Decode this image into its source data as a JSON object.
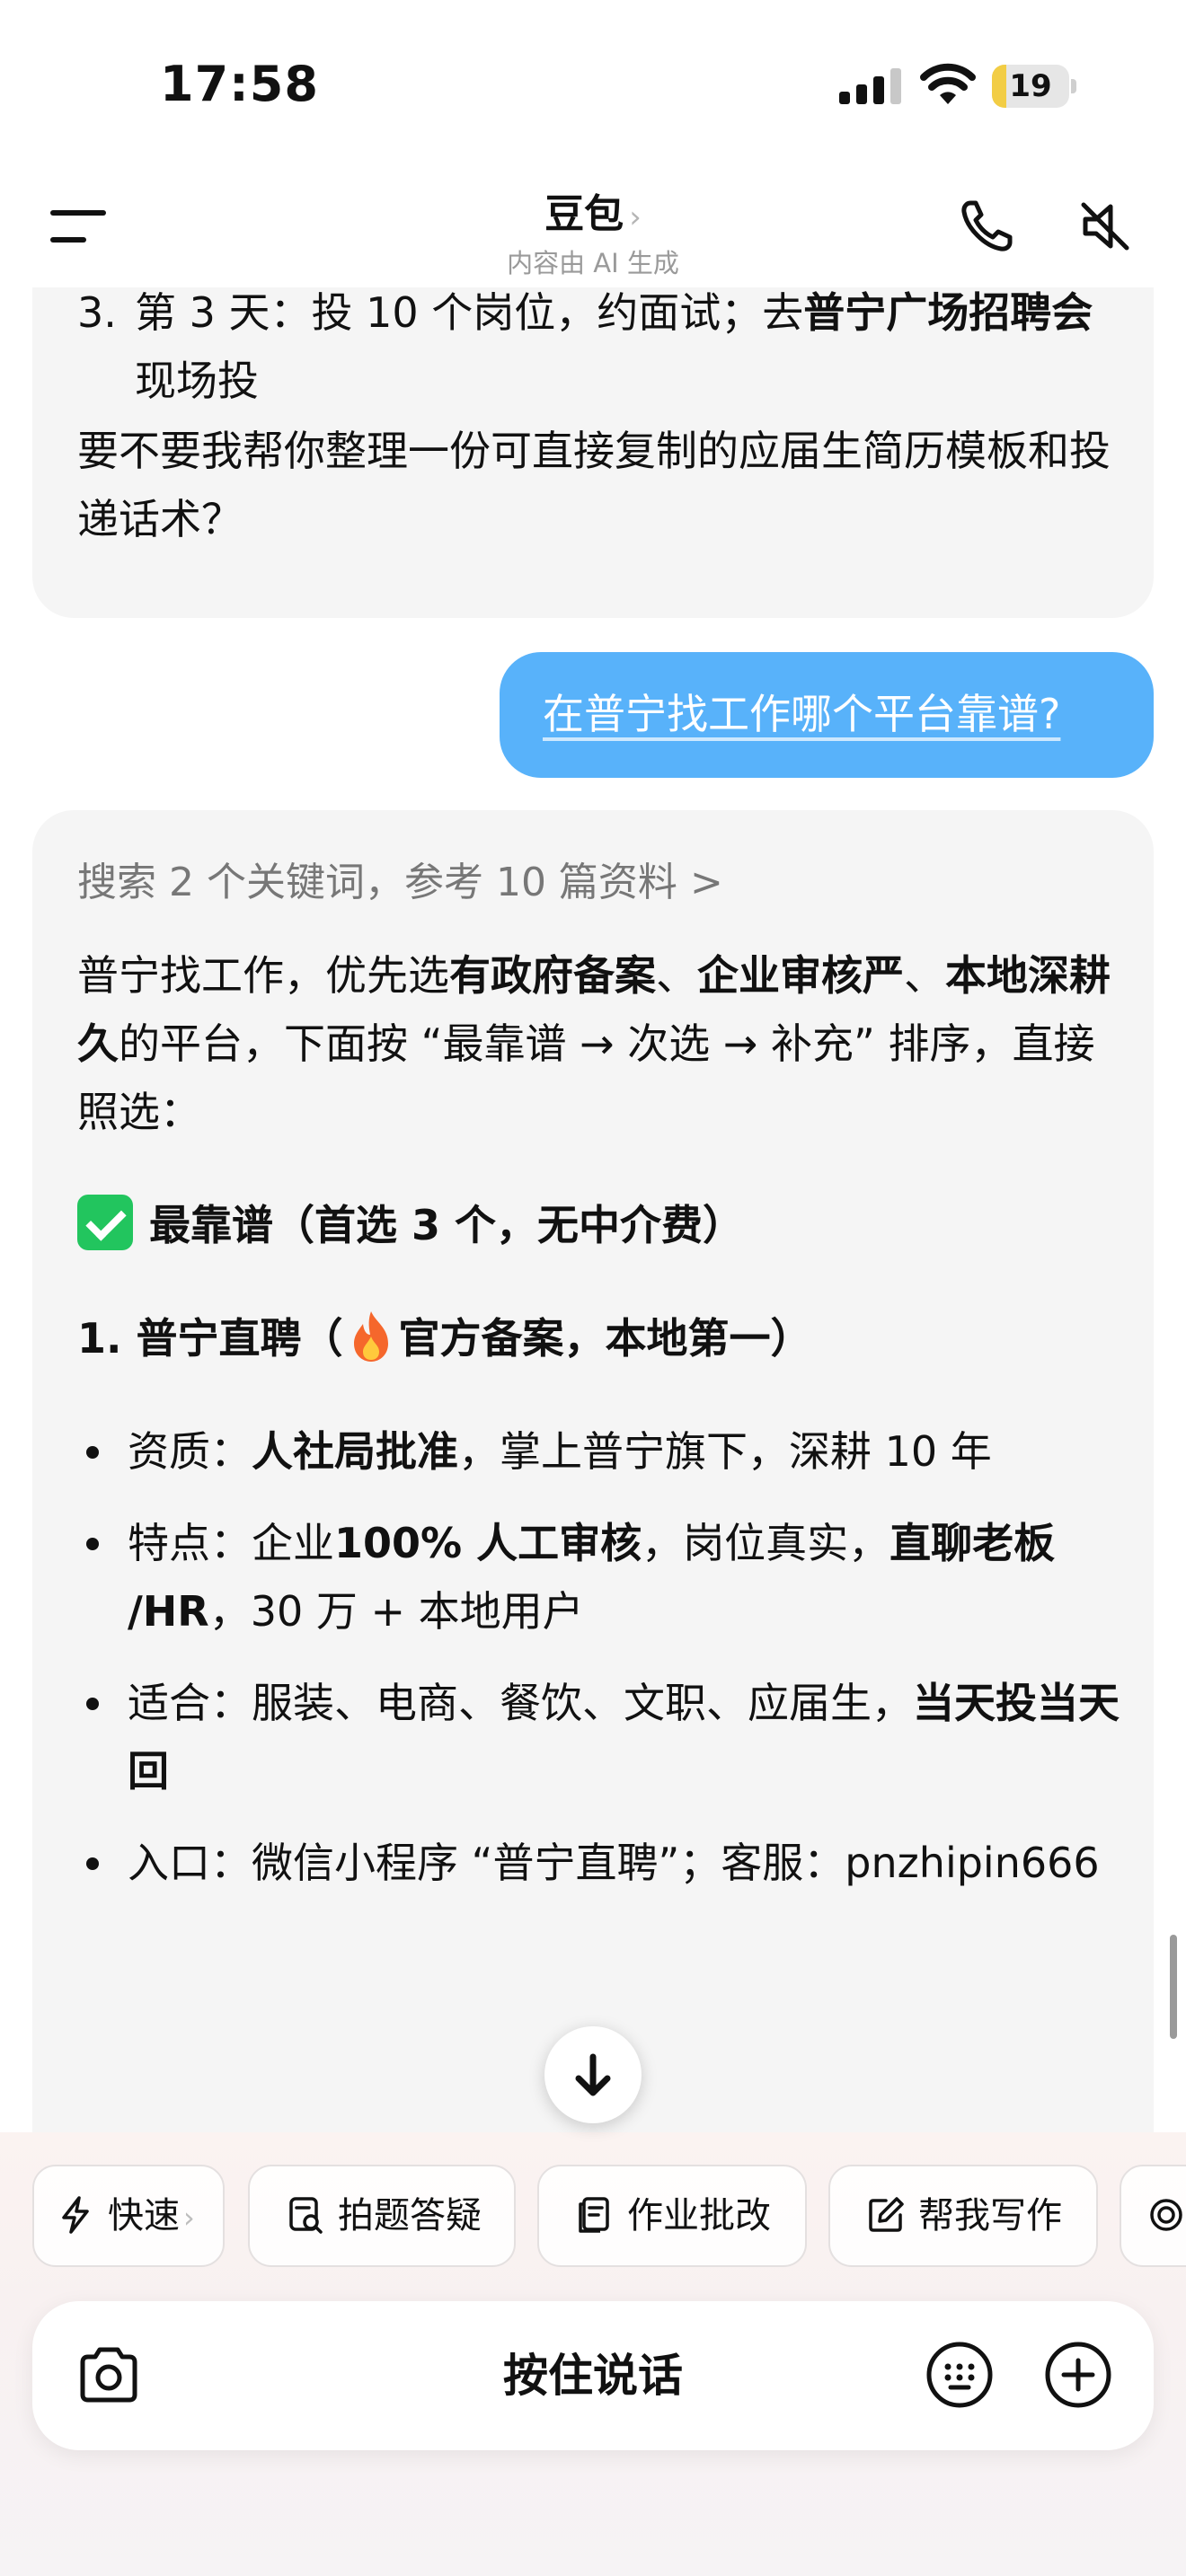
{
  "status_bar": {
    "time": "17:58",
    "battery_level": "19",
    "battery_fraction": 0.19,
    "icons": [
      "cellular-signal-icon",
      "wifi-icon",
      "battery-icon"
    ]
  },
  "nav": {
    "title": "豆包",
    "title_chevron": "›",
    "subtitle": "内容由 AI 生成",
    "icons": [
      "menu-icon",
      "phone-icon",
      "speaker-mute-icon"
    ]
  },
  "messages": {
    "ai_prev": {
      "item3_num": "3.",
      "item3_a": "第 3 天：投 10 个岗位，约面试；去",
      "item3_b": "普宁广场招聘会",
      "item3_c": "现场投",
      "ask": "要不要我帮你整理一份可直接复制的应届生简历模板和投递话术？"
    },
    "user": {
      "text": "在普宁找工作哪个平台靠谱?"
    },
    "ai": {
      "search_ref": "搜索 2 个关键词，参考 10 篇资料",
      "search_chevron": ">",
      "intro_1": "普宁找工作，优先选",
      "intro_b1": "有政府备案",
      "intro_2": "、",
      "intro_b2": "企业审核严",
      "intro_3": "、",
      "intro_b3": "本地深耕久",
      "intro_4": "的平台，下面按 “最靠谱 → 次选 → 补充” 排序，直接照选：",
      "section_title": "最靠谱（首选 3 个，无中介费）",
      "item1_a": "1. 普宁直聘（",
      "item1_b": "官方备案，本地第一）",
      "b1_label": "资质：",
      "b1_bold": "人社局批准",
      "b1_rest": "，掌上普宁旗下，深耕 10 年",
      "b2_label": "特点：企业",
      "b2_bold1": "100% 人工审核",
      "b2_mid": "，岗位真实，",
      "b2_bold2": "直聊老板 /HR",
      "b2_rest": "，30 万 + 本地用户",
      "b3_label": "适合：服装、电商、餐饮、文职、应届生，",
      "b3_bold": "当天投当天回",
      "b4_text": "入口：微信小程序 “普宁直聘”；客服：pnzhipin666"
    }
  },
  "quick_actions": [
    {
      "label": "快速",
      "icon": "lightning-icon",
      "chevron": "›"
    },
    {
      "label": "拍题答疑",
      "icon": "photo-search-icon"
    },
    {
      "label": "作业批改",
      "icon": "homework-check-icon"
    },
    {
      "label": "帮我写作",
      "icon": "edit-icon"
    }
  ],
  "composer": {
    "hold_to_talk": "按住说话",
    "icons": [
      "camera-icon",
      "keyboard-icon",
      "plus-icon"
    ]
  },
  "colors": {
    "user_bubble": "#58b2fa",
    "ai_bubble": "#f5f5f5",
    "battery_fill": "#f2cd45",
    "check_green": "#22c55e",
    "image_red": "#d9573d"
  }
}
